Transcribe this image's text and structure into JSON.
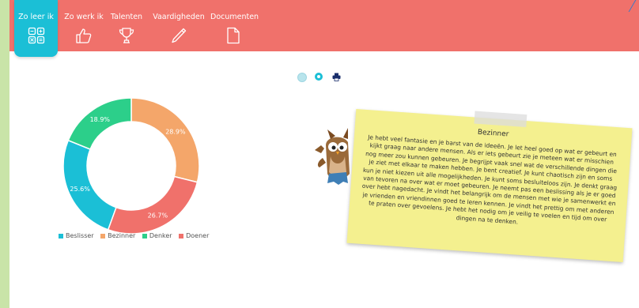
{
  "nav": {
    "tabs": [
      {
        "label": "Zo leer ik",
        "icon": "grid-icon",
        "active": true
      },
      {
        "label": "Zo werk ik",
        "icon": "thumbs-up-icon",
        "active": false
      },
      {
        "label": "Talenten",
        "icon": "trophy-icon",
        "active": false
      },
      {
        "label": "Vaardigheden",
        "icon": "pencil-icon",
        "active": false
      },
      {
        "label": "Documenten",
        "icon": "document-icon",
        "active": false
      }
    ]
  },
  "colors": {
    "nav_bg": "#f0716b",
    "active_tab": "#1bbfd6",
    "beslisser": "#1bbfd6",
    "bezinner": "#f4a66a",
    "denker": "#2ccf8a",
    "doener": "#f0716b",
    "note": "#f4f08f"
  },
  "controls": [
    {
      "icon": "circle-light-icon"
    },
    {
      "icon": "circle-dark-icon"
    },
    {
      "icon": "print-icon"
    }
  ],
  "chart_data": {
    "type": "pie",
    "donut": true,
    "series": [
      {
        "name": "Beslisser",
        "value": 25.6,
        "label": "25.6%"
      },
      {
        "name": "Bezinner",
        "value": 28.9,
        "label": "28.9%"
      },
      {
        "name": "Denker",
        "value": 18.9,
        "label": "18.9%"
      },
      {
        "name": "Doener",
        "value": 26.7,
        "label": "26.7%"
      }
    ],
    "legend_position": "bottom-left"
  },
  "note": {
    "title": "Bezinner",
    "text": "Je hebt veel fantasie en je barst van de ideeën. Je let heel goed op wat er gebeurt en kijkt graag naar andere mensen. Als er iets gebeurt zie je meteen wat er misschien nog meer zou kunnen gebeuren. Je begrijpt vaak snel wat de verschillende dingen die je ziet met elkaar te maken hebben. Je bent creatief. Je kunt chaotisch zijn en soms kun je niet kiezen uit alle mogelijkheden. Je kunt soms besluiteloos zijn. Je denkt graag van tevoren na over wat er moet gebeuren. Je neemt pas een beslissing als je er goed over hebt nagedacht. Je vindt het belangrijk om de mensen met wie je samenwerkt en je vrienden en vriendinnen goed te leren kennen. Je vindt het prettig om met anderen te praten over gevoelens. Je hebt het nodig om je veilig te voelen en tijd om over dingen na te denken."
  },
  "mascot": {
    "icon": "owl-mascot-icon"
  }
}
